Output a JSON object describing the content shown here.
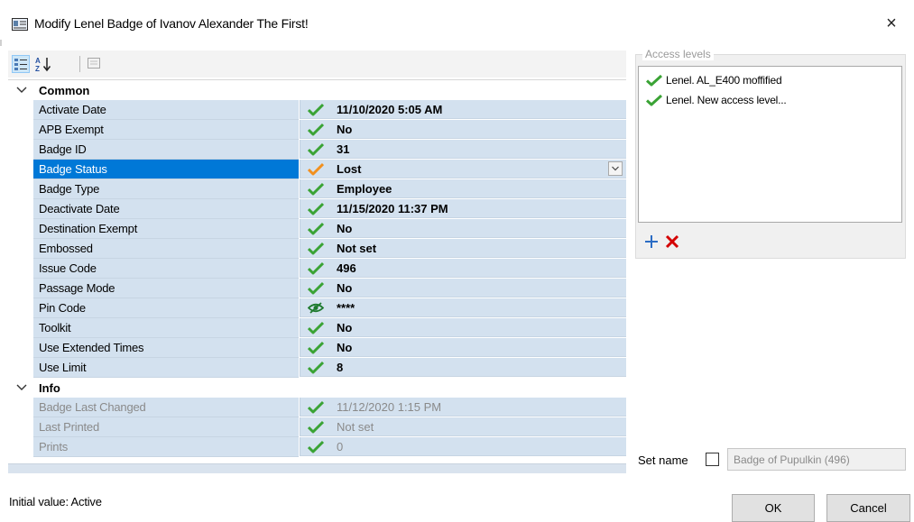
{
  "window": {
    "title": "Modify Lenel Badge of Ivanov Alexander The First!",
    "close_glyph": "×"
  },
  "toolbar": {
    "icons": [
      "categorized-view-icon",
      "alphabetical-sort-icon",
      "property-pages-icon"
    ]
  },
  "grid": {
    "categories": [
      {
        "label": "Common",
        "properties": [
          {
            "name": "Activate Date",
            "value": "11/10/2020 5:05 AM",
            "icon": "check-icon"
          },
          {
            "name": "APB Exempt",
            "value": "No",
            "icon": "check-icon"
          },
          {
            "name": "Badge ID",
            "value": "31",
            "icon": "check-icon"
          },
          {
            "name": "Badge Status",
            "value": "Lost",
            "icon": "check-orange-icon",
            "selected": true
          },
          {
            "name": "Badge Type",
            "value": "Employee",
            "icon": "check-icon"
          },
          {
            "name": "Deactivate Date",
            "value": "11/15/2020 11:37 PM",
            "icon": "check-icon"
          },
          {
            "name": "Destination Exempt",
            "value": "No",
            "icon": "check-icon"
          },
          {
            "name": "Embossed",
            "value": "Not set",
            "icon": "check-icon"
          },
          {
            "name": "Issue Code",
            "value": "496",
            "icon": "check-icon"
          },
          {
            "name": "Passage Mode",
            "value": "No",
            "icon": "check-icon"
          },
          {
            "name": "Pin Code",
            "value": "****",
            "icon": "hidden-eye-icon"
          },
          {
            "name": "Toolkit",
            "value": "No",
            "icon": "check-icon"
          },
          {
            "name": "Use Extended Times",
            "value": "No",
            "icon": "check-icon"
          },
          {
            "name": "Use Limit",
            "value": "8",
            "icon": "check-icon"
          }
        ]
      },
      {
        "label": "Info",
        "properties": [
          {
            "name": "Badge Last Changed",
            "value": "11/12/2020 1:15 PM",
            "icon": "check-icon",
            "disabled": true
          },
          {
            "name": "Last Printed",
            "value": "Not set",
            "icon": "check-icon",
            "disabled": true
          },
          {
            "name": "Prints",
            "value": "0",
            "icon": "check-icon",
            "disabled": true
          }
        ]
      }
    ]
  },
  "access_levels": {
    "legend": "Access levels",
    "items": [
      {
        "label": "Lenel. AL_E400 moffified"
      },
      {
        "label": "Lenel. New access level..."
      }
    ]
  },
  "set_name": {
    "label": "Set name",
    "checked": false,
    "value": "Badge of Pupulkin (496)"
  },
  "status": {
    "text": "Initial value: Active"
  },
  "buttons": {
    "ok": "OK",
    "cancel": "Cancel"
  },
  "colors": {
    "check": "#3aa335",
    "check_orange": "#f2901e",
    "selection": "#0078d7",
    "row_bg": "#d3e1ef",
    "delete": "#d40000",
    "add": "#2b6cc4"
  }
}
